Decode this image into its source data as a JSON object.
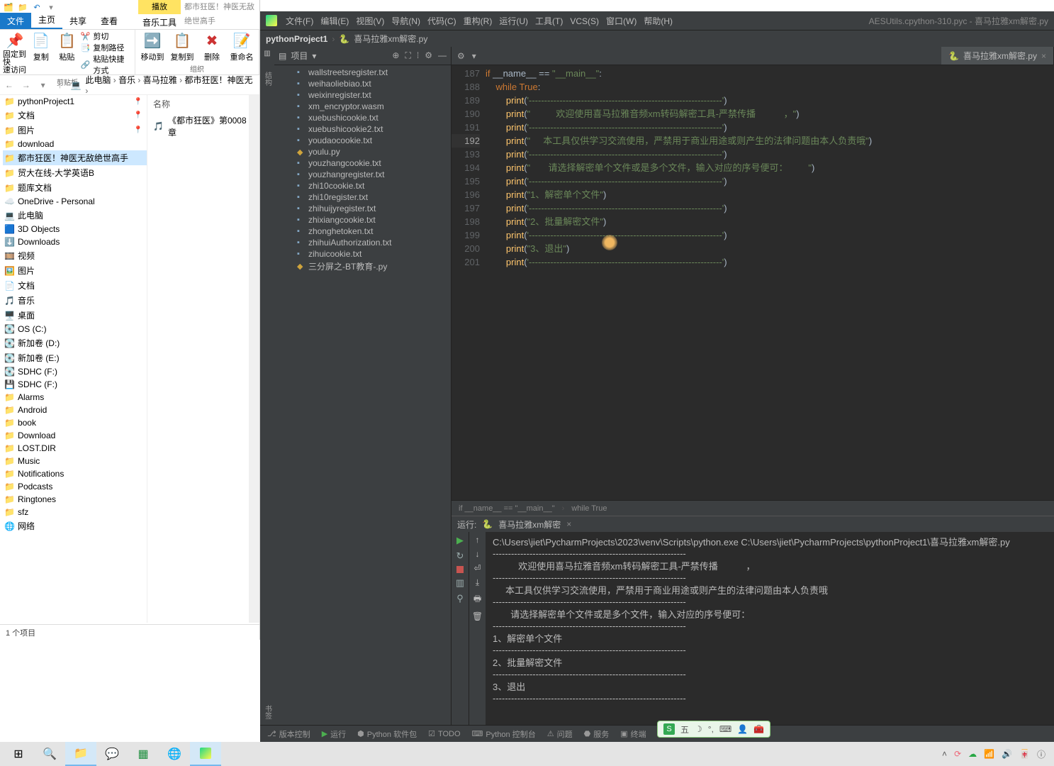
{
  "explorer": {
    "qat_play_tab": "播放",
    "qat_title": "都市狂医！神医无敌绝世高手",
    "tabs": {
      "file": "文件",
      "home": "主页",
      "share": "共享",
      "view": "查看",
      "music_tools": "音乐工具"
    },
    "ribbon": {
      "pin": "固定到快\n速访问",
      "copy": "复制",
      "paste": "粘贴",
      "cut": "剪切",
      "copy_path": "复制路径",
      "paste_shortcut": "粘贴快捷方式",
      "clipboard_group": "剪贴板",
      "move_to": "移动到",
      "copy_to": "复制到",
      "delete": "删除",
      "rename": "重命名",
      "organize_group": "组织"
    },
    "crumbs": [
      "此电脑",
      "音乐",
      "喜马拉雅",
      "都市狂医！神医无"
    ],
    "tree": {
      "pinned": [
        {
          "label": "pythonProject1",
          "pin": true
        },
        {
          "label": "文档",
          "pin": true
        },
        {
          "label": "图片",
          "pin": true
        },
        {
          "label": "download"
        },
        {
          "label": "都市狂医！神医无敌绝世高手",
          "selected": true
        },
        {
          "label": "贸大在线-大学英语B"
        },
        {
          "label": "题库文档"
        }
      ],
      "onedrive": "OneDrive - Personal",
      "this_pc": "此电脑",
      "pc_children": [
        "3D Objects",
        "Downloads",
        "视频",
        "图片",
        "文档",
        "音乐",
        "桌面",
        "OS (C:)",
        "新加卷 (D:)",
        "新加卷 (E:)",
        "SDHC (F:)"
      ],
      "sdhc": "SDHC (F:)",
      "sdhc_children": [
        "Alarms",
        "Android",
        "book",
        "Download",
        "LOST.DIR",
        "Music",
        "Notifications",
        "Podcasts",
        "Ringtones",
        "sfz"
      ],
      "network": "网络"
    },
    "listing": {
      "header": "名称",
      "item": "《都市狂医》第0008章 "
    },
    "status": "1 个项目"
  },
  "pycharm": {
    "menus": [
      "文件(F)",
      "编辑(E)",
      "视图(V)",
      "导航(N)",
      "代码(C)",
      "重构(R)",
      "运行(U)",
      "工具(T)",
      "VCS(S)",
      "窗口(W)",
      "帮助(H)"
    ],
    "title": "AESUtils.cpython-310.pyc - 喜马拉雅xm解密.py",
    "breadcrumb": {
      "project": "pythonProject1",
      "file": "喜马拉雅xm解密.py"
    },
    "project_label": "项目",
    "files": [
      "wallstreetsregister.txt",
      "weihaoliebiao.txt",
      "weixinregister.txt",
      "xm_encryptor.wasm",
      "xuebushicookie.txt",
      "xuebushicookie2.txt",
      "youdaocookie.txt",
      "youlu.py",
      "youzhangcookie.txt",
      "youzhangregister.txt",
      "zhi10cookie.txt",
      "zhi10register.txt",
      "zhihuijyregister.txt",
      "zhixiangcookie.txt",
      "zhonghetoken.txt",
      "zhihuiAuthorization.txt",
      "zihuicookie.txt",
      "三分屏之-BT教育-.py"
    ],
    "editor_tab": "喜马拉雅xm解密.py",
    "lines_start": 187,
    "code": [
      {
        "kw": "if",
        "rest": " __name__ == ",
        "str": "\"__main__\"",
        "tail": ":"
      },
      {
        "indent": 1,
        "kw": "while",
        "rest": " ",
        "kw2": "True",
        "tail": ":"
      },
      {
        "indent": 2,
        "fn": "print",
        "arg": "'---------------------------------------------------------------'"
      },
      {
        "indent": 2,
        "fn": "print",
        "arg": "\"          欢迎使用喜马拉雅音频xm转码解密工具-严禁传播           ，\""
      },
      {
        "indent": 2,
        "fn": "print",
        "arg": "'---------------------------------------------------------------'"
      },
      {
        "indent": 2,
        "fn": "print",
        "arg": "\"     本工具仅供学习交流使用，严禁用于商业用途或则产生的法律问题由本人负责哦\""
      },
      {
        "indent": 2,
        "fn": "print",
        "arg": "'---------------------------------------------------------------'"
      },
      {
        "indent": 2,
        "fn": "print",
        "arg": "\"       请选择解密单个文件或是多个文件，输入对应的序号便可：        \""
      },
      {
        "indent": 2,
        "fn": "print",
        "arg": "'---------------------------------------------------------------'"
      },
      {
        "indent": 2,
        "fn": "print",
        "arg": "\"1、解密单个文件\""
      },
      {
        "indent": 2,
        "fn": "print",
        "arg": "'---------------------------------------------------------------'"
      },
      {
        "indent": 2,
        "fn": "print",
        "arg": "\"2、批量解密文件\""
      },
      {
        "indent": 2,
        "fn": "print",
        "arg": "'---------------------------------------------------------------'"
      },
      {
        "indent": 2,
        "fn": "print",
        "arg": "\"3、退出\""
      },
      {
        "indent": 2,
        "fn": "print",
        "arg": "'---------------------------------------------------------------'"
      }
    ],
    "editor_crumb": [
      "if __name__ == \"__main__\"",
      "while True"
    ],
    "run": {
      "label": "运行:",
      "config": "喜马拉雅xm解密",
      "cmd": "C:\\Users\\jiet\\PycharmProjects\\2023\\venv\\Scripts\\python.exe C:\\Users\\jiet\\PycharmProjects\\pythonProject1\\喜马拉雅xm解密.py",
      "lines": [
        "---------------------------------------------------------------",
        "          欢迎使用喜马拉雅音频xm转码解密工具-严禁传播           ，",
        "---------------------------------------------------------------",
        "     本工具仅供学习交流使用，严禁用于商业用途或则产生的法律问题由本人负责哦",
        "---------------------------------------------------------------",
        "       请选择解密单个文件或是多个文件，输入对应的序号便可：",
        "---------------------------------------------------------------",
        "1、解密单个文件",
        "---------------------------------------------------------------",
        "2、批量解密文件",
        "---------------------------------------------------------------",
        "3、退出",
        "---------------------------------------------------------------"
      ]
    },
    "statusbar": {
      "vcs": "版本控制",
      "run": "运行",
      "pkg": "Python 软件包",
      "todo": "TODO",
      "console": "Python 控制台",
      "problems": "问题",
      "services": "服务",
      "terminal": "终端"
    }
  },
  "ime": {
    "label": "五"
  },
  "icons": {
    "folder": "📁",
    "file": "📄",
    "back": "←",
    "fwd": "→",
    "up": "↑"
  }
}
